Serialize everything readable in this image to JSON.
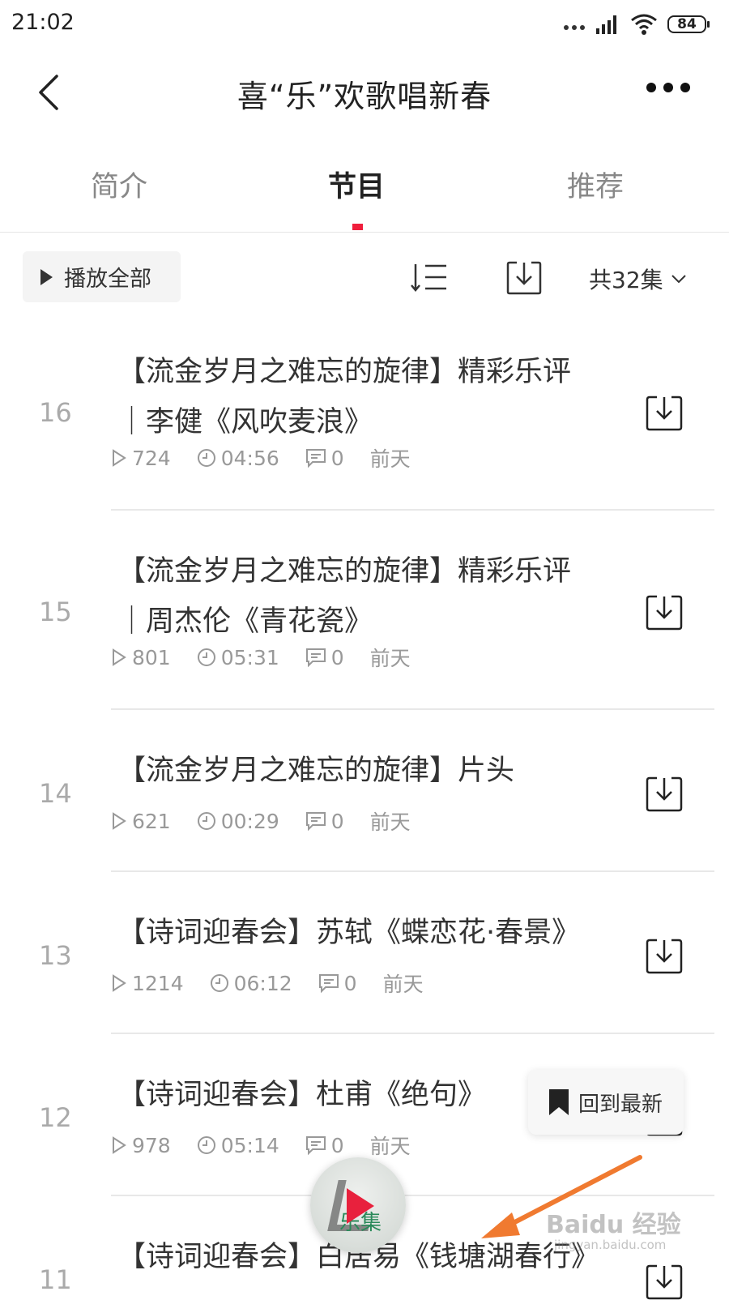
{
  "status_bar": {
    "time": "21:02",
    "battery": "84"
  },
  "header": {
    "title": "喜“乐”欢歌唱新春"
  },
  "tabs": [
    {
      "label": "简介"
    },
    {
      "label": "节目"
    },
    {
      "label": "推荐"
    }
  ],
  "toolbar": {
    "play_all_label": "播放全部",
    "episode_count": "共32集"
  },
  "episodes": [
    {
      "number": "16",
      "title_line1": "【流金岁月之难忘的旋律】精彩乐评",
      "title_line2": "｜李健《风吹麦浪》",
      "plays": "724",
      "duration": "04:56",
      "comments": "0",
      "date": "前天"
    },
    {
      "number": "15",
      "title_line1": "【流金岁月之难忘的旋律】精彩乐评",
      "title_line2": "｜周杰伦《青花瓷》",
      "plays": "801",
      "duration": "05:31",
      "comments": "0",
      "date": "前天"
    },
    {
      "number": "14",
      "title_line1": "【流金岁月之难忘的旋律】片头",
      "plays": "621",
      "duration": "00:29",
      "comments": "0",
      "date": "前天"
    },
    {
      "number": "13",
      "title_line1": "【诗词迎春会】苏轼《蝶恋花·春景》",
      "plays": "1214",
      "duration": "06:12",
      "comments": "0",
      "date": "前天"
    },
    {
      "number": "12",
      "title_line1": "【诗词迎春会】杜甫《绝句》",
      "plays": "978",
      "duration": "05:14",
      "comments": "0",
      "date": "前天"
    },
    {
      "number": "11",
      "title_line1": "【诗词迎春会】白居易《钱塘湖春行》"
    }
  ],
  "floating": {
    "back_to_latest": "回到最新",
    "mini_player_art_text": "乐集"
  },
  "watermark": {
    "text": "Baidu 经验",
    "sub": "jingyan.baidu.com"
  },
  "colors": {
    "accent": "#f01e3c",
    "arrow": "#f07a30"
  },
  "icons": {
    "back": "chevron-left-icon",
    "more": "more-dots-icon",
    "sort": "sort-order-icon",
    "download": "download-icon",
    "play": "play-icon",
    "clock": "clock-icon",
    "comment": "comment-icon",
    "bookmark": "bookmark-icon",
    "chevron": "chevron-down-icon"
  }
}
